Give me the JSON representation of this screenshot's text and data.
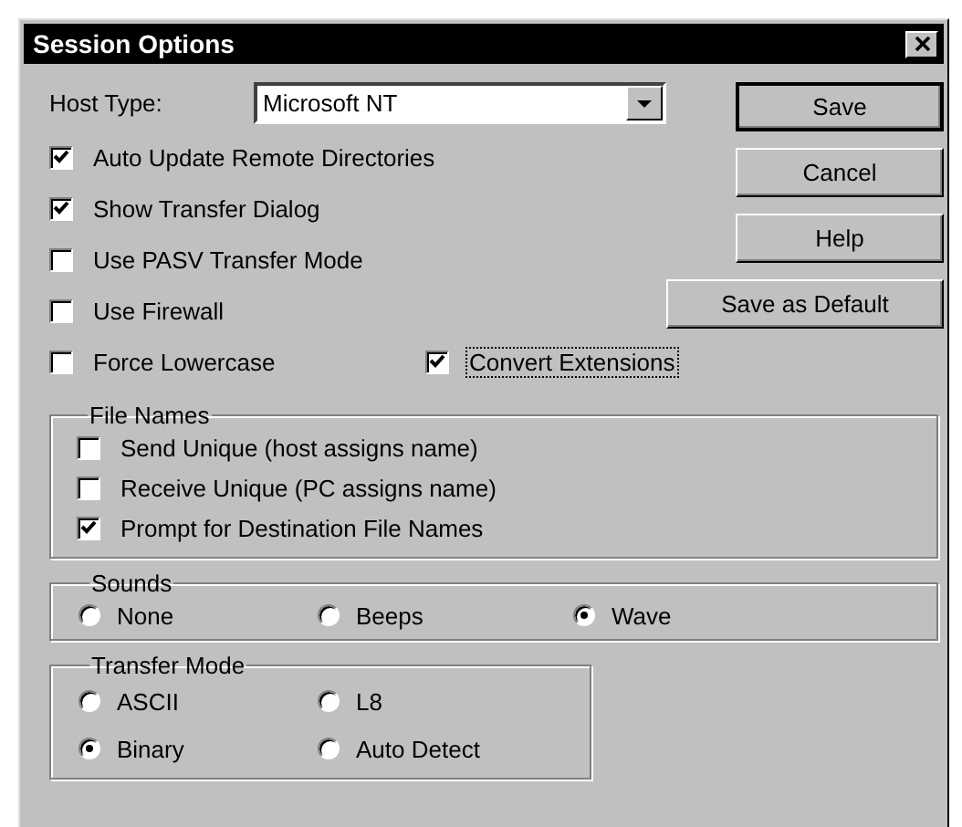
{
  "window": {
    "title": "Session Options"
  },
  "host_type": {
    "label": "Host Type:",
    "value": "Microsoft NT"
  },
  "options": [
    {
      "label": "Auto Update Remote Directories",
      "checked": true,
      "focused": false
    },
    {
      "label": "Show Transfer Dialog",
      "checked": true,
      "focused": false
    },
    {
      "label": "Use PASV Transfer Mode",
      "checked": false,
      "focused": false
    },
    {
      "label": "Use Firewall",
      "checked": false,
      "focused": false
    },
    {
      "label": "Force Lowercase",
      "checked": false,
      "focused": false
    },
    {
      "label": "Convert Extensions",
      "checked": true,
      "focused": true
    }
  ],
  "buttons": [
    {
      "label": "Save",
      "default": true
    },
    {
      "label": "Cancel",
      "default": false
    },
    {
      "label": "Help",
      "default": false
    },
    {
      "label": "Save as Default",
      "default": false
    }
  ],
  "file_names": {
    "title": "File Names",
    "options": [
      {
        "label": "Send Unique (host assigns name)",
        "checked": false
      },
      {
        "label": "Receive Unique (PC assigns name)",
        "checked": false
      },
      {
        "label": "Prompt for Destination File Names",
        "checked": true
      }
    ]
  },
  "sounds": {
    "title": "Sounds",
    "options": [
      {
        "label": "None",
        "selected": false
      },
      {
        "label": "Beeps",
        "selected": false
      },
      {
        "label": "Wave",
        "selected": true
      }
    ]
  },
  "transfer_mode": {
    "title": "Transfer Mode",
    "options": [
      {
        "label": "ASCII",
        "selected": false
      },
      {
        "label": "L8",
        "selected": false
      },
      {
        "label": "Binary",
        "selected": true
      },
      {
        "label": "Auto Detect",
        "selected": false
      }
    ]
  }
}
